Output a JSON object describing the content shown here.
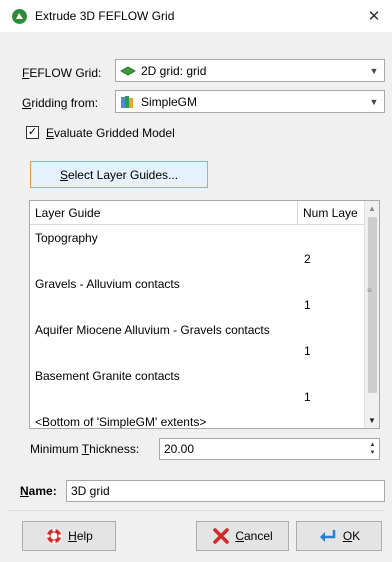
{
  "window": {
    "title": "Extrude 3D FEFLOW Grid",
    "close_glyph": "✕"
  },
  "feflow_grid": {
    "label_first": "F",
    "label_rest": "EFLOW Grid:",
    "value": "2D grid: grid",
    "icon": "feflow-grid-icon"
  },
  "gridding_from": {
    "label_first": "G",
    "label_rest": "ridding from:",
    "value": "SimpleGM",
    "icon": "geological-model-icon"
  },
  "evaluate": {
    "checked_glyph": "✓",
    "label_first": "E",
    "label_rest": "valuate Gridded Model"
  },
  "select_layer_button": {
    "label_first": "S",
    "label_rest": "elect Layer Guides..."
  },
  "layer_table": {
    "headers": {
      "layer_guide": "Layer Guide",
      "num_layers": "Num Laye"
    },
    "rows": [
      {
        "name": "Topography",
        "num": "2"
      },
      {
        "name": "Gravels - Alluvium contacts",
        "num": "1"
      },
      {
        "name": "Aquifer Miocene Alluvium - Gravels contacts",
        "num": "1"
      },
      {
        "name": "Basement Granite contacts",
        "num": "1"
      },
      {
        "name": "<Bottom of 'SimpleGM' extents>",
        "num": ""
      }
    ]
  },
  "min_thickness": {
    "label_pre": "Minimum ",
    "label_u": "T",
    "label_post": "hickness:",
    "value": "20.00"
  },
  "name_field": {
    "label_u": "N",
    "label_rest": "ame:",
    "value": "3D grid"
  },
  "footer": {
    "help": {
      "u": "H",
      "rest": "elp"
    },
    "cancel": {
      "u": "C",
      "rest": "ancel"
    },
    "ok": {
      "u": "O",
      "rest": "K"
    }
  },
  "colors": {
    "accent_focus": "#f0a036",
    "window_bg": "#f0f0f0"
  }
}
